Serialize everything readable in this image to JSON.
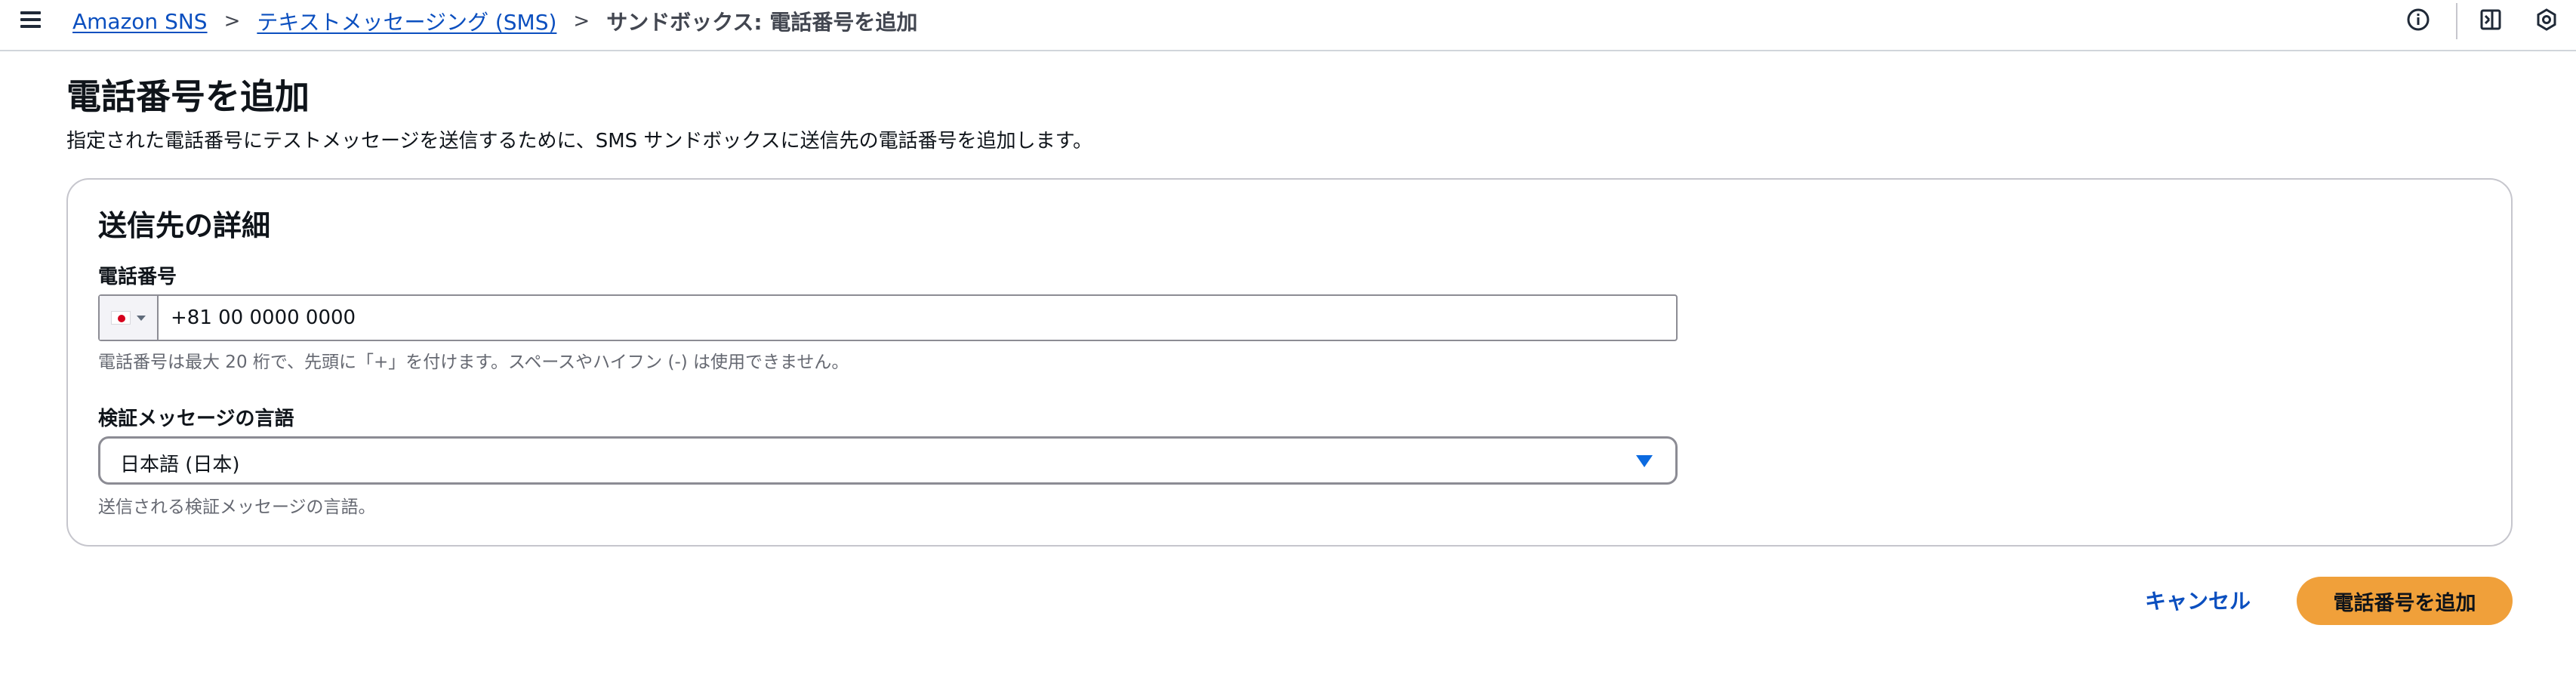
{
  "topbar": {
    "menu_icon": "hamburger-menu-icon",
    "breadcrumb": {
      "items": [
        {
          "label": "Amazon SNS",
          "link": true
        },
        {
          "label": "テキストメッセージング (SMS)",
          "link": true
        },
        {
          "label": "サンドボックス: 電話番号を追加",
          "link": false
        }
      ],
      "separator": ">"
    },
    "icons": [
      "info-icon",
      "notes-panel-icon",
      "settings-hexagon-icon"
    ]
  },
  "page": {
    "title": "電話番号を追加",
    "description": "指定された電話番号にテストメッセージを送信するために、SMS サンドボックスに送信先の電話番号を追加します。"
  },
  "panel": {
    "title": "送信先の詳細",
    "phone": {
      "label": "電話番号",
      "country_flag": "japan-flag-icon",
      "value": "+81 00 0000 0000",
      "hint": "電話番号は最大 20 桁で、先頭に「+」を付けます。スペースやハイフン (-) は使用できません。"
    },
    "language": {
      "label": "検証メッセージの言語",
      "selected": "日本語 (日本)",
      "hint": "送信される検証メッセージの言語。"
    }
  },
  "actions": {
    "cancel_label": "キャンセル",
    "submit_label": "電話番号を追加"
  },
  "colors": {
    "link": "#0b4fbf",
    "primary_button": "#f0a03a",
    "dropdown_caret": "#0b6ae0",
    "border": "#c6c6cd"
  }
}
